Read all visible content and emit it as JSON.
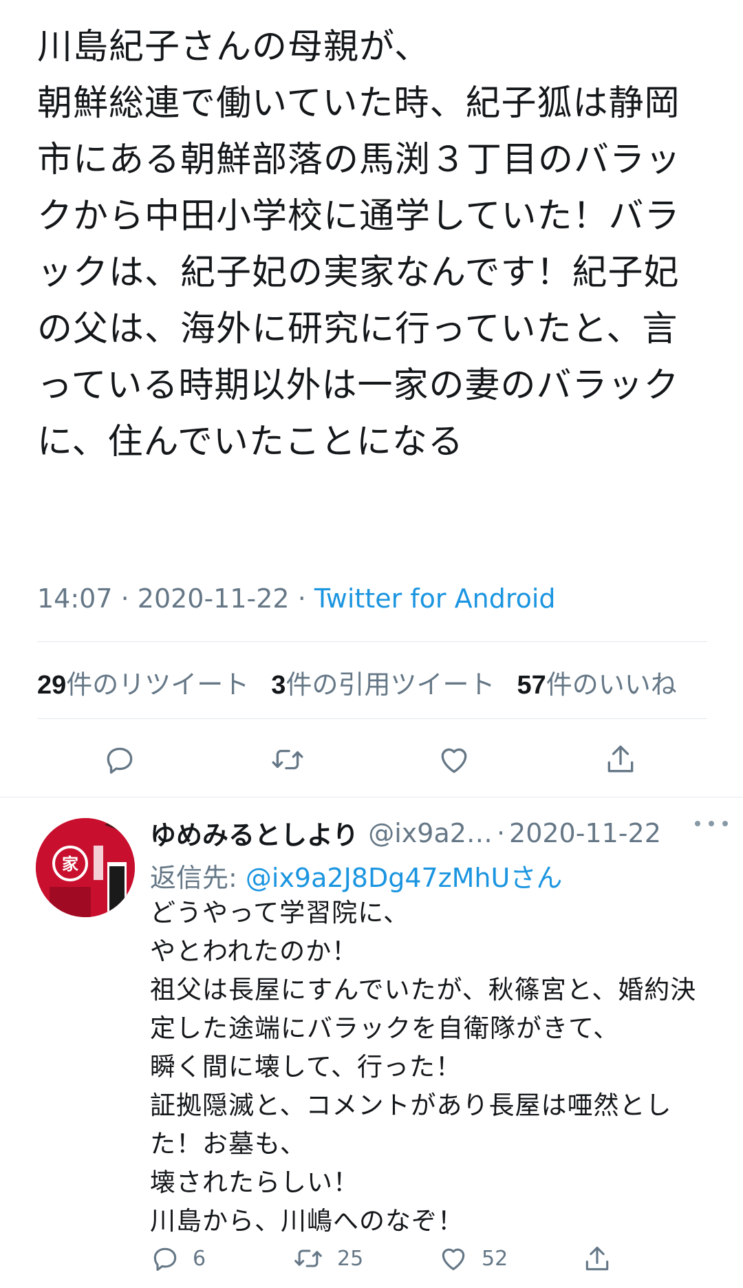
{
  "tweet": {
    "text": "川島紀子さんの母親が、\n朝鮮総連で働いていた時、紀子狐は静岡市にある朝鮮部落の馬渕３丁目のバラックから中田小学校に通学していた！バラックは、紀子妃の実家なんです！紀子妃の父は、海外に研究に行っていたと、言っている時期以外は一家の妻のバラックに、住んでいたことになる",
    "time": "14:07",
    "date": "2020-11-22",
    "separator": " · ",
    "source": "Twitter for Android",
    "stats": {
      "retweets_count": "29",
      "retweets_label": "件のリツイート",
      "quotes_count": "3",
      "quotes_label": "件の引用ツイート",
      "likes_count": "57",
      "likes_label": "件のいいね"
    },
    "actions": [
      "reply-icon",
      "retweet-icon",
      "like-icon",
      "share-icon"
    ]
  },
  "reply": {
    "name": "ゆめみるとしより",
    "handle": "@ix9a2…",
    "dot": "·",
    "date": "2020-11-22",
    "reply_to_label": "返信先: ",
    "reply_to_handle": "@ix9a2J8Dg47zMhU",
    "reply_to_suffix": "さん",
    "text": "どうやって学習院に、\nやとわれたのか！\n祖父は長屋にすんでいたが、秋篠宮と、婚約決定した途端にバラックを自衛隊がきて、\n瞬く間に壊して、行った！\n証拠隠滅と、コメントがあり長屋は唖然とした！お墓も、\n壊されたらしい！\n川島から、川嶋へのなぞ！",
    "reply_count": "6",
    "retweet_count": "25",
    "like_count": "52",
    "avatar_colors": {
      "main": "#c8102e",
      "accent": "#ffffff",
      "band": "#f5c400"
    }
  },
  "colors": {
    "text": "#14171a",
    "secondary": "#657786",
    "link": "#1b95e0",
    "divider": "#e1e8ed"
  }
}
